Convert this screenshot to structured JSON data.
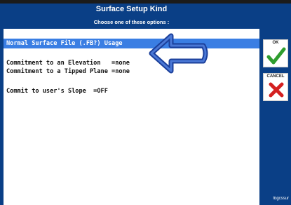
{
  "window": {
    "title": "Surface Setup Kind",
    "subtitle": "Choose one of these options :"
  },
  "options": [
    {
      "label": "Normal Surface File (.FB?) Usage",
      "selected": true
    },
    {
      "label": ""
    },
    {
      "label": "Commitment to an Elevation   =none"
    },
    {
      "label": "Commitment to a Tipped Plane =none"
    },
    {
      "label": ""
    },
    {
      "label": "Commit to user's Slope  =OFF"
    }
  ],
  "buttons": {
    "ok_label": "OK",
    "cancel_label": "CANCEL"
  },
  "icons": {
    "ok": "checkmark-icon",
    "cancel": "x-icon",
    "pointer": "arrow-left-icon"
  },
  "colors": {
    "header": "#0a3f86",
    "selection": "#3a7ee3",
    "ok": "#2e9d2e",
    "cancel": "#d42020"
  },
  "footer": {
    "program": "fbgcssur"
  }
}
